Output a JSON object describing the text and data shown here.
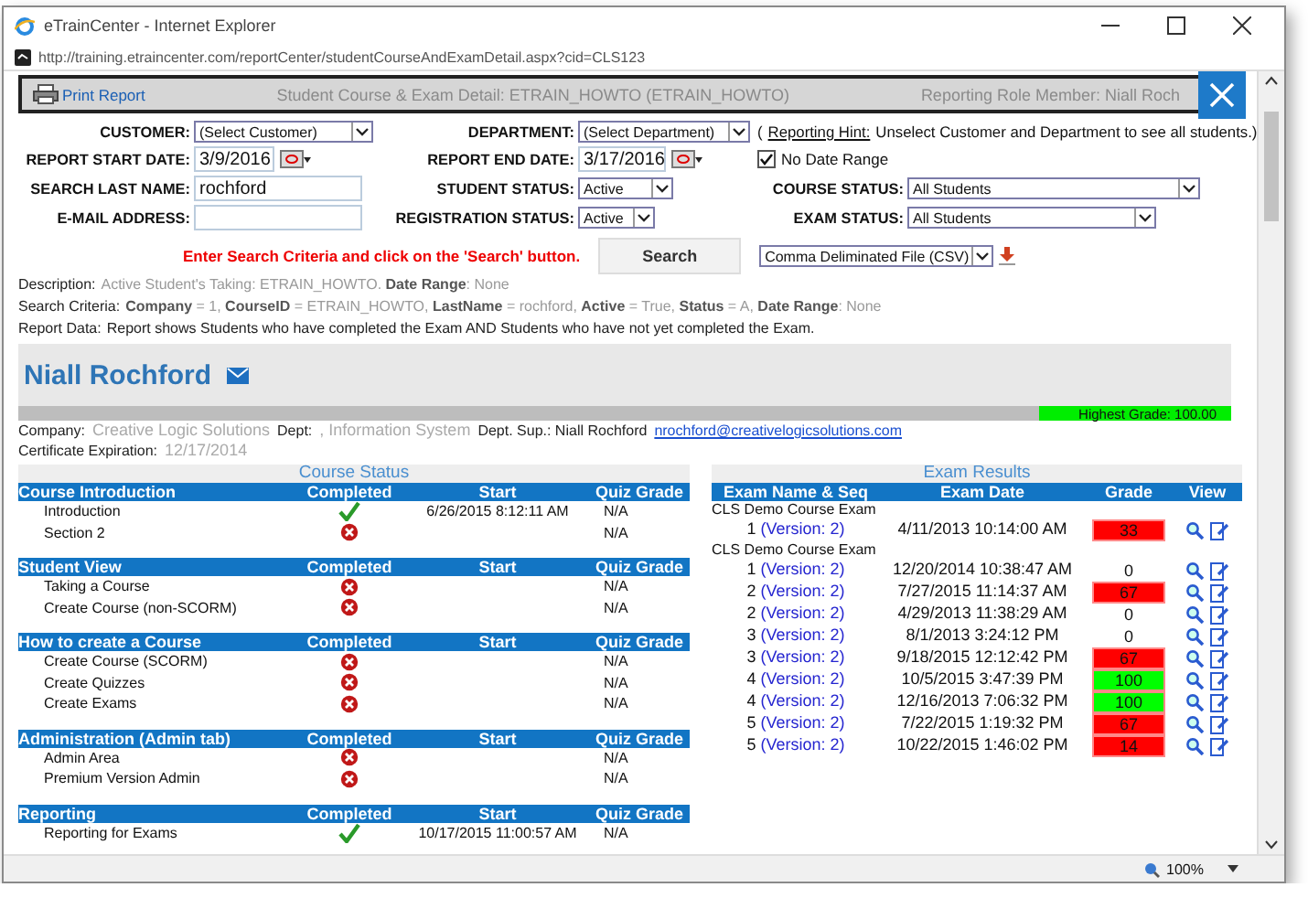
{
  "window": {
    "title": "eTrainCenter - Internet Explorer",
    "url": "http://training.etraincenter.com/reportCenter/studentCourseAndExamDetail.aspx?cid=CLS123",
    "zoom": "100%"
  },
  "report_header": {
    "print": "Print Report",
    "title": "Student Course & Exam Detail: ETRAIN_HOWTO (ETRAIN_HOWTO)",
    "role": "Reporting Role Member: Niall Roch"
  },
  "form": {
    "customer_label": "CUSTOMER:",
    "customer": "(Select Customer)",
    "department_label": "DEPARTMENT:",
    "department": "(Select Department)",
    "hint_label": "Reporting Hint:",
    "hint": "Unselect Customer and Department to see all students.)",
    "hint_open": "(",
    "start_label": "REPORT START DATE:",
    "start": "3/9/2016",
    "end_label": "REPORT END DATE:",
    "end": "3/17/2016",
    "no_range_label": "No Date Range",
    "no_range_checked": true,
    "lastname_label": "SEARCH LAST NAME:",
    "lastname": "rochford",
    "student_status_label": "STUDENT STATUS:",
    "student_status": "Active",
    "course_status_label": "COURSE STATUS:",
    "course_status": "All Students",
    "email_label": "E-MAIL ADDRESS:",
    "registration_label": "REGISTRATION STATUS:",
    "registration": "Active",
    "exam_status_label": "EXAM STATUS:",
    "exam_status": "All Students",
    "message": "Enter Search Criteria and click on the 'Search' button.",
    "search": "Search",
    "export": "Comma Deliminated File (CSV)"
  },
  "info": [
    {
      "label": "Description:",
      "text": "Active Student's Taking: ETRAIN_HOWTO. **Date Range**: None"
    },
    {
      "label": "Search Criteria:",
      "text": "**Company** = 1, **CourseID** = ETRAIN_HOWTO, **LastName** = rochford, **Active** = True, **Status** = A, **Date Range**: None"
    },
    {
      "label": "Report Data:",
      "text": "Report shows Students who have completed the Exam AND Students who have not yet completed the Exam.",
      "dark": true
    }
  ],
  "student": {
    "name": "Niall Rochford",
    "highest_grade": "Highest Grade: 100.00",
    "company_label": "Company:",
    "company": "Creative Logic Solutions",
    "dept_label": "Dept:",
    "dept": ", Information System",
    "sup_label": "Dept. Sup.: Niall Rochford",
    "sup_email": "nrochford@creativelogicsolutions.com",
    "cert_label": "Certificate Expiration:",
    "cert": "12/17/2014"
  },
  "course_status": {
    "title": "Course Status",
    "groups": [
      {
        "name": "Course Introduction",
        "columns": [
          "Completed",
          "Start",
          "Quiz Grade"
        ],
        "items": [
          {
            "name": "Introduction",
            "completed": true,
            "start": "6/26/2015 8:12:11 AM",
            "grade": "N/A"
          },
          {
            "name": "Section 2",
            "completed": false,
            "grade": "N/A"
          }
        ]
      },
      {
        "name": "Student View",
        "columns": [
          "Completed",
          "Start",
          "Quiz Grade"
        ],
        "items": [
          {
            "name": "Taking a Course",
            "completed": false,
            "grade": "N/A"
          },
          {
            "name": "Create Course (non-SCORM)",
            "completed": false,
            "grade": "N/A"
          }
        ]
      },
      {
        "name": "How to create a Course",
        "columns": [
          "Completed",
          "Start",
          "Quiz Grade"
        ],
        "items": [
          {
            "name": "Create Course (SCORM)",
            "completed": false,
            "grade": "N/A"
          },
          {
            "name": "Create Quizzes",
            "completed": false,
            "grade": "N/A"
          },
          {
            "name": "Create Exams",
            "completed": false,
            "grade": "N/A"
          }
        ]
      },
      {
        "name": "Administration (Admin tab)",
        "columns": [
          "Completed",
          "Start",
          "Quiz Grade"
        ],
        "items": [
          {
            "name": "Admin Area",
            "completed": false,
            "grade": "N/A"
          },
          {
            "name": "Premium Version Admin",
            "completed": false,
            "grade": "N/A"
          }
        ]
      },
      {
        "name": "Reporting",
        "columns": [
          "Completed",
          "Start",
          "Quiz Grade"
        ],
        "items": [
          {
            "name": "Reporting for Exams",
            "completed": true,
            "start": "10/17/2015 11:00:57 AM",
            "grade": "N/A"
          }
        ]
      }
    ]
  },
  "exam_results": {
    "title": "Exam Results",
    "columns": [
      "Exam Name & Seq",
      "Exam Date",
      "Grade",
      "View"
    ],
    "groups": [
      {
        "name": "CLS Demo Course Exam",
        "rows": [
          {
            "seq": "1",
            "version": "(Version: 2)",
            "date": "4/11/2013 10:14:00 AM",
            "grade": "33",
            "color": "#ff0000"
          }
        ]
      },
      {
        "name": "CLS Demo Course Exam",
        "rows": [
          {
            "seq": "1",
            "version": "(Version: 2)",
            "date": "12/20/2014 10:38:47 AM",
            "grade": "0"
          },
          {
            "seq": "2",
            "version": "(Version: 2)",
            "date": "7/27/2015 11:14:37 AM",
            "grade": "67",
            "color": "#ff0000"
          },
          {
            "seq": "2",
            "version": "(Version: 2)",
            "date": "4/29/2013 11:38:29 AM",
            "grade": "0"
          },
          {
            "seq": "3",
            "version": "(Version: 2)",
            "date": "8/1/2013 3:24:12 PM",
            "grade": "0"
          },
          {
            "seq": "3",
            "version": "(Version: 2)",
            "date": "9/18/2015 12:12:42 PM",
            "grade": "67",
            "color": "#ff0000"
          },
          {
            "seq": "4",
            "version": "(Version: 2)",
            "date": "10/5/2015 3:47:39 PM",
            "grade": "100",
            "color": "#00ff00"
          },
          {
            "seq": "4",
            "version": "(Version: 2)",
            "date": "12/16/2013 7:06:32 PM",
            "grade": "100",
            "color": "#00ff00"
          },
          {
            "seq": "5",
            "version": "(Version: 2)",
            "date": "7/22/2015 1:19:32 PM",
            "grade": "67",
            "color": "#ff0000"
          },
          {
            "seq": "5",
            "version": "(Version: 2)",
            "date": "10/22/2015 1:46:02 PM",
            "grade": "14",
            "color": "#ff0000"
          }
        ]
      }
    ]
  }
}
